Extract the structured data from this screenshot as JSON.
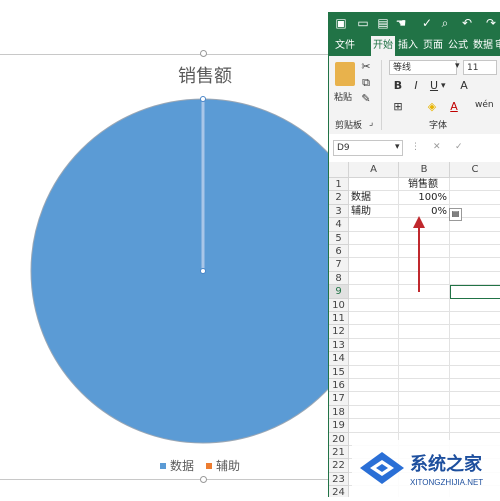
{
  "chart": {
    "title": "销售额",
    "legend": [
      {
        "label": "数据",
        "color": "#5b9bd5"
      },
      {
        "label": "辅助",
        "color": "#ed7d31"
      }
    ]
  },
  "chart_data": {
    "type": "pie",
    "title": "销售额",
    "categories": [
      "数据",
      "辅助"
    ],
    "values": [
      1.0,
      0.0
    ],
    "colors": [
      "#5b9bd5",
      "#ed7d31"
    ],
    "legend": "bottom"
  },
  "excel": {
    "tabs": [
      "文件",
      "开始",
      "插入",
      "页面",
      "公式",
      "数据",
      "审"
    ],
    "active_tab": "开始",
    "ribbon": {
      "paste_label": "粘贴",
      "clipboard_group": "剪贴板",
      "font_name": "等线",
      "font_size": "11",
      "bold": "B",
      "italic": "I",
      "underline": "U",
      "font_group": "字体",
      "grow_font": "A",
      "font_color_glyph": "A",
      "phonetic": "wén"
    },
    "name_box": "D9",
    "formula_cancel": "✕",
    "formula_enter": "✓",
    "columns": [
      "A",
      "B",
      "C"
    ],
    "rows": [
      {
        "n": "1",
        "a": "",
        "b": "销售额"
      },
      {
        "n": "2",
        "a": "数据",
        "b": "100%"
      },
      {
        "n": "3",
        "a": "辅助",
        "b": "0%"
      },
      {
        "n": "4",
        "a": "",
        "b": ""
      },
      {
        "n": "5",
        "a": "",
        "b": ""
      },
      {
        "n": "6",
        "a": "",
        "b": ""
      },
      {
        "n": "7",
        "a": "",
        "b": ""
      },
      {
        "n": "8",
        "a": "",
        "b": ""
      },
      {
        "n": "9",
        "a": "",
        "b": ""
      },
      {
        "n": "10",
        "a": "",
        "b": ""
      },
      {
        "n": "11",
        "a": "",
        "b": ""
      },
      {
        "n": "12",
        "a": "",
        "b": ""
      },
      {
        "n": "13",
        "a": "",
        "b": ""
      },
      {
        "n": "14",
        "a": "",
        "b": ""
      },
      {
        "n": "15",
        "a": "",
        "b": ""
      },
      {
        "n": "16",
        "a": "",
        "b": ""
      },
      {
        "n": "17",
        "a": "",
        "b": ""
      },
      {
        "n": "18",
        "a": "",
        "b": ""
      },
      {
        "n": "19",
        "a": "",
        "b": ""
      },
      {
        "n": "20",
        "a": "",
        "b": ""
      },
      {
        "n": "21",
        "a": "",
        "b": ""
      },
      {
        "n": "22",
        "a": "",
        "b": ""
      },
      {
        "n": "23",
        "a": "",
        "b": ""
      },
      {
        "n": "24",
        "a": "",
        "b": ""
      }
    ],
    "active_row": "9"
  },
  "watermark": {
    "brand": "系统之家",
    "url": "XITONGZHIJIA.NET"
  }
}
